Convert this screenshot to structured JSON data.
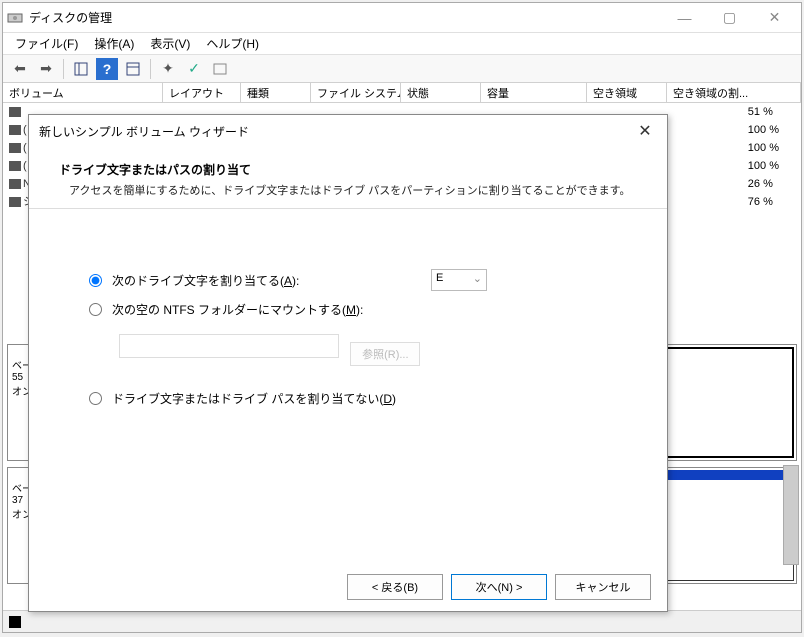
{
  "window": {
    "title": "ディスクの管理",
    "min": "—",
    "max": "▢",
    "close": "✕"
  },
  "menu": {
    "file": "ファイル(F)",
    "action": "操作(A)",
    "view": "表示(V)",
    "help": "ヘルプ(H)"
  },
  "columns": {
    "volume": "ボリューム",
    "layout": "レイアウト",
    "type": "種類",
    "fs": "ファイル システム",
    "status": "状態",
    "capacity": "容量",
    "free": "空き領域",
    "freepct": "空き領域の割..."
  },
  "visible_pct": [
    "51 %",
    "100 %",
    "100 %",
    "100 %",
    "26 %",
    "76 %"
  ],
  "disk_left": {
    "a_line1": "ベー",
    "a_line2": "55",
    "a_line3": "オン",
    "b_line1": "ベー",
    "b_line2": "37",
    "b_line3": "オン"
  },
  "dialog": {
    "title": "新しいシンプル ボリューム ウィザード",
    "heading": "ドライブ文字またはパスの割り当て",
    "sub": "アクセスを簡単にするために、ドライブ文字またはドライブ パスをパーティションに割り当てることができます。",
    "opt1_a": "次のドライブ文字を割り当てる(",
    "opt1_u": "A",
    "opt1_b": "):",
    "drive": "E",
    "opt2_a": "次の空の NTFS フォルダーにマウントする(",
    "opt2_u": "M",
    "opt2_b": "):",
    "browse": "参照(R)...",
    "opt3_a": "ドライブ文字またはドライブ パスを割り当てない(",
    "opt3_u": "D",
    "opt3_b": ")",
    "back": "< 戻る(B)",
    "next": "次へ(N) >",
    "cancel": "キャンセル"
  }
}
